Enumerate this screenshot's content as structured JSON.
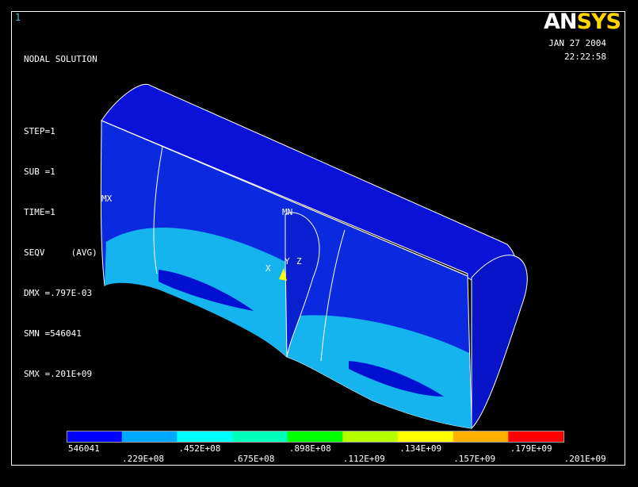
{
  "window_number": "1",
  "header": {
    "title": "NODAL SOLUTION",
    "step": "STEP=1",
    "sub": "SUB =1",
    "time": "TIME=1",
    "seqv": "SEQV     (AVG)",
    "dmx": "DMX =.797E-03",
    "smn": "SMN =546041",
    "smx": "SMX =.201E+09"
  },
  "logo": {
    "part1": "AN",
    "part2": "SYS"
  },
  "date": {
    "day": "JAN 27 2004",
    "time": "22:22:58"
  },
  "markers": {
    "mx": "MX",
    "mn": "MN",
    "x": "X",
    "y": "Y",
    "z": "Z"
  },
  "legend": {
    "colors": [
      "#0000ff",
      "#00a8ff",
      "#00ffff",
      "#00ffb8",
      "#00ff00",
      "#b8ff00",
      "#ffff00",
      "#ffb000",
      "#ff0000"
    ],
    "labels_bottom": [
      "546041",
      ".452E+08",
      ".898E+08",
      ".134E+09",
      ".179E+09"
    ],
    "labels_top": [
      ".229E+08",
      ".675E+08",
      ".112E+09",
      ".157E+09",
      ".201E+09"
    ]
  }
}
